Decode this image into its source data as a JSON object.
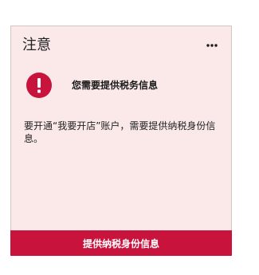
{
  "card": {
    "title": "注意",
    "more_icon": "more-horizontal-icon",
    "notice": {
      "icon": "exclamation-circle-icon",
      "heading": "您需要提供税务信息"
    },
    "body": "要开通“我要开店”账户，需要提供纳税身份信息。",
    "action_label": "提供纳税身份信息"
  },
  "colors": {
    "card_background": "#fbe9e9",
    "accent": "#c8143c",
    "text": "#222222"
  }
}
